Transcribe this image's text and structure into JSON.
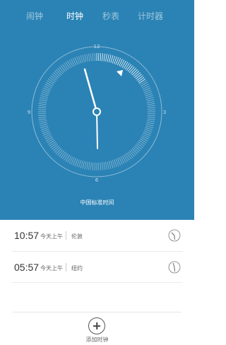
{
  "tabs": [
    {
      "label": "闹钟"
    },
    {
      "label": "时钟"
    },
    {
      "label": "秒表"
    },
    {
      "label": "计时器"
    }
  ],
  "active_tab": "时钟",
  "clock": {
    "numerals": {
      "top": "12",
      "right": "3",
      "bottom": "6",
      "left": "9"
    },
    "timezone_label": "中国标准时间"
  },
  "world_clocks": [
    {
      "time": "10:57",
      "day": "今天上午",
      "city": "伦敦"
    },
    {
      "time": "05:57",
      "day": "今天上午",
      "city": "纽约"
    }
  ],
  "add_clock_label": "添加时钟",
  "colors": {
    "header_bg": "#2b83b5",
    "list_bg": "#ffffff"
  },
  "icons": {
    "add": "plus-icon",
    "mini_clock": "clock-icon"
  }
}
